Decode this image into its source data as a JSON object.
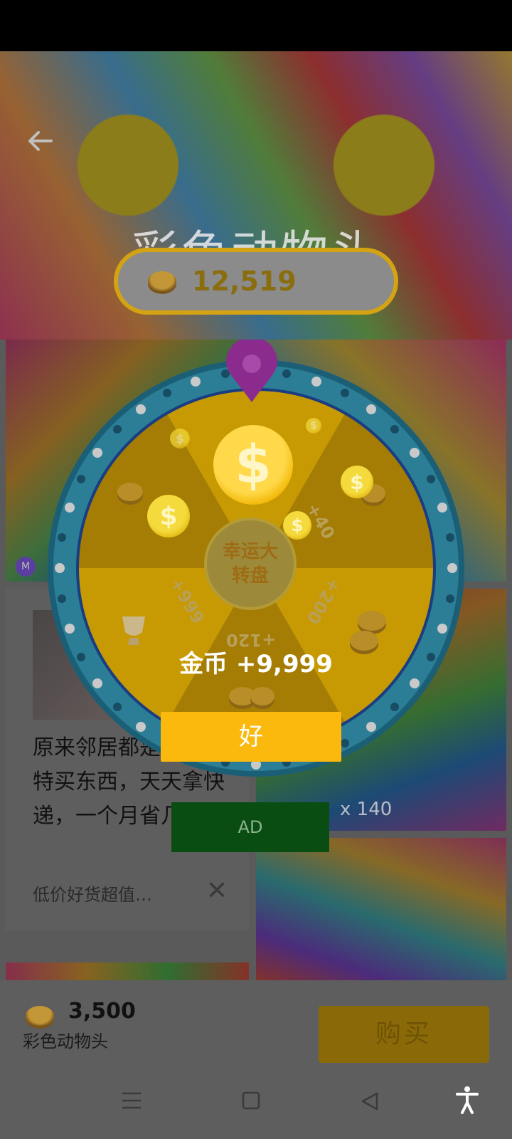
{
  "header": {
    "title": "彩色动物头",
    "coin_balance": "12,519"
  },
  "grid": {
    "badge": "M",
    "count_label": "x 140"
  },
  "ad_card": {
    "text": "原来邻居都是在这里特买东西，天天拿快递，一个月省几百！",
    "subtext": "低价好货超值…",
    "close": "✕"
  },
  "wheel": {
    "hub_line1": "幸运大",
    "hub_line2": "转盘",
    "segments": [
      "+40",
      "+200",
      "+120",
      "+999"
    ]
  },
  "popup": {
    "reward_text": "金币 +9,999",
    "ok_label": "好",
    "ad_label": "AD"
  },
  "bottom": {
    "price": "3,500",
    "item_name": "彩色动物头",
    "buy_label": "购买"
  },
  "icons": {
    "back": "arrow-left-icon",
    "coin": "coin-icon",
    "menu": "menu-icon",
    "home": "square-icon",
    "back_nav": "triangle-back-icon",
    "accessibility": "accessibility-icon"
  }
}
